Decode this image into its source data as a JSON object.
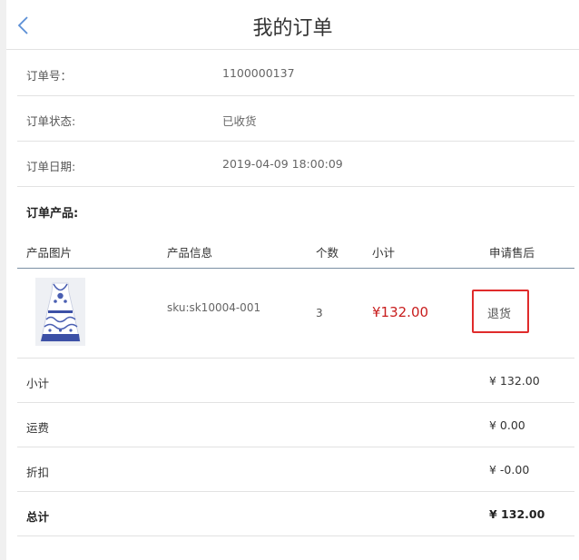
{
  "header": {
    "title": "我的订单"
  },
  "order": {
    "number_label": "订单号：",
    "number_value": "1100000137",
    "status_label": "订单状态:",
    "status_value": "已收货",
    "date_label": "订单日期:",
    "date_value": "2019-04-09 18:00:09"
  },
  "products_section": {
    "title": "订单产品:",
    "columns": [
      "产品图片",
      "产品信息",
      "个数",
      "小计",
      "申请售后"
    ],
    "items": [
      {
        "sku": "sku:sk10004-001",
        "quantity": "3",
        "subtotal": "¥132.00",
        "action_label": "退货"
      }
    ]
  },
  "summary": [
    {
      "label": "小计",
      "value": "¥ 132.00"
    },
    {
      "label": "运费",
      "value": "¥ 0.00"
    },
    {
      "label": "折扣",
      "value": "¥ -0.00"
    },
    {
      "label": "总计",
      "value": "¥ 132.00"
    }
  ],
  "colors": {
    "price_red": "#c81d1d",
    "highlight_border": "#e02b2b",
    "back_icon": "#5b8fd6"
  },
  "icons": {
    "back": "chevron-left-icon"
  }
}
